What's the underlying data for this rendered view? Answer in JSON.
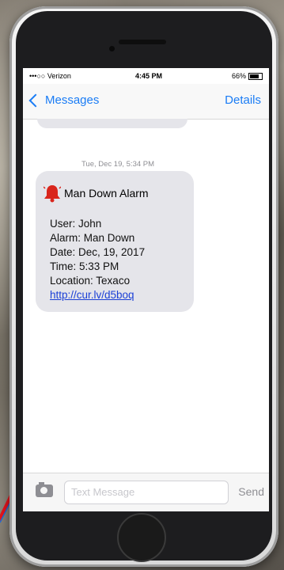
{
  "status_bar": {
    "carrier": "•••○○ Verizon",
    "time": "4:45 PM",
    "battery": "66%"
  },
  "nav": {
    "back_label": "Messages",
    "details_label": "Details"
  },
  "thread": {
    "timestamp": "Tue, Dec 19, 5:34 PM",
    "message": {
      "title": "Man Down Alarm",
      "lines": {
        "user": "User: John",
        "alarm": "Alarm: Man Down",
        "date": "Date: Dec, 19, 2017",
        "time": "Time: 5:33 PM",
        "location": "Location: Texaco"
      },
      "link": "http://cur.lv/d5boq"
    }
  },
  "composer": {
    "placeholder": "Text Message",
    "send_label": "Send"
  },
  "colors": {
    "accent": "#1a7cf5",
    "bubble": "#e5e5ea",
    "alarm_icon": "#d9251c",
    "arrow_red": "#e8141c",
    "arrow_blue": "#1e6fd8"
  }
}
